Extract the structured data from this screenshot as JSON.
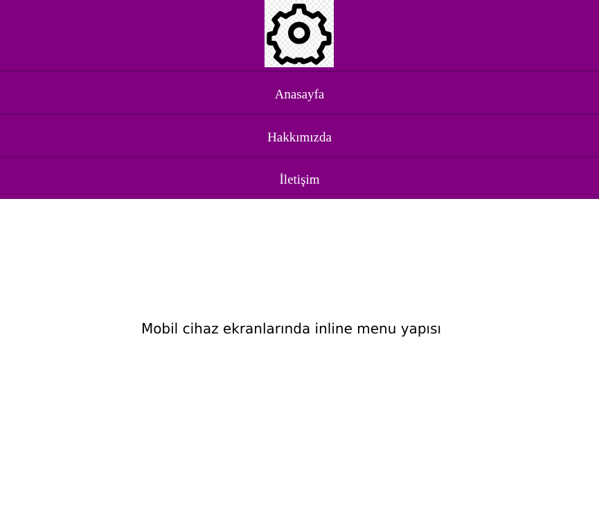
{
  "logo": {
    "icon": "gear-icon"
  },
  "nav": {
    "items": [
      {
        "label": "Anasayfa"
      },
      {
        "label": "Hakkımızda"
      },
      {
        "label": "İletişim"
      }
    ]
  },
  "main": {
    "text": "Mobil cihaz ekranlarında inline menu yapısı"
  },
  "colors": {
    "header_bg": "#800080",
    "divider": "#5a005a",
    "menu_text": "#ffffff"
  }
}
